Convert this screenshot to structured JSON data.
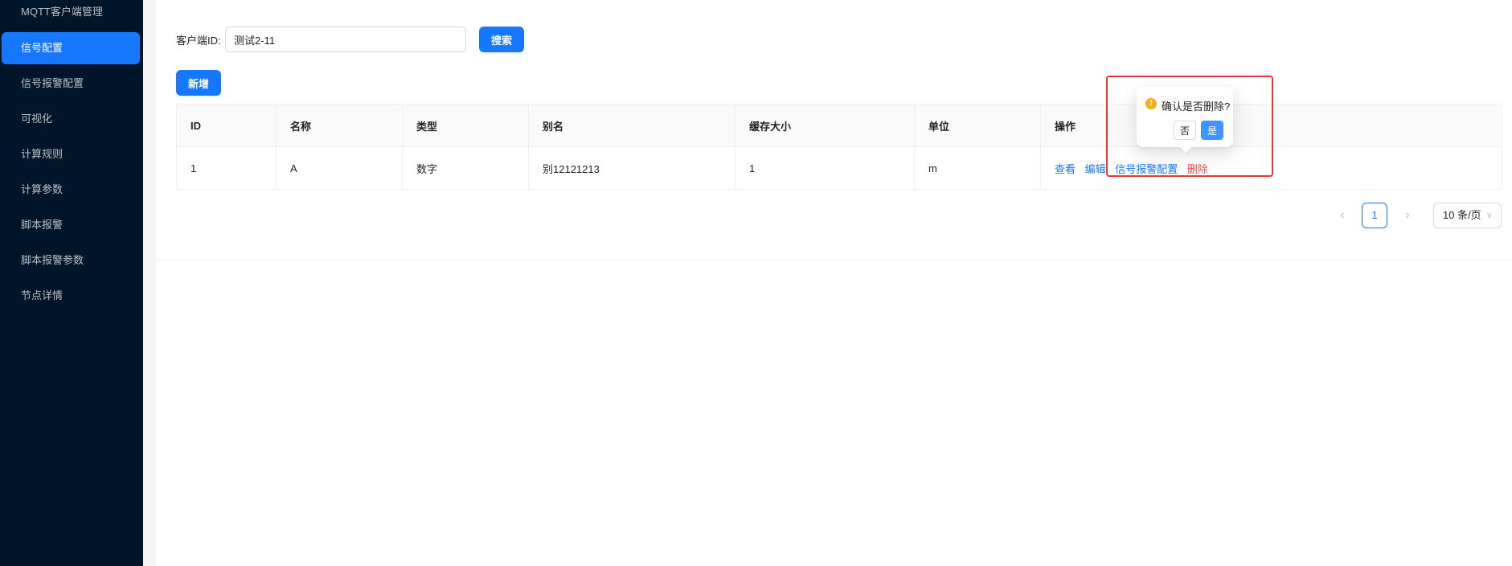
{
  "sidebar": {
    "items": [
      {
        "label": "MQTT客户端管理"
      },
      {
        "label": "信号配置"
      },
      {
        "label": "信号报警配置"
      },
      {
        "label": "可视化"
      },
      {
        "label": "计算规则"
      },
      {
        "label": "计算参数"
      },
      {
        "label": "脚本报警"
      },
      {
        "label": "脚本报警参数"
      },
      {
        "label": "节点详情"
      }
    ],
    "active": "信号配置"
  },
  "search": {
    "label": "客户端ID:",
    "value": "测试2-11",
    "button": "搜索"
  },
  "toolbar": {
    "add_label": "新增"
  },
  "table": {
    "columns": [
      "ID",
      "名称",
      "类型",
      "别名",
      "缓存大小",
      "单位",
      "操作"
    ],
    "rows": [
      {
        "id": "1",
        "name": "A",
        "type": "数字",
        "alias": "别12121213",
        "cache": "1",
        "unit": "m"
      }
    ],
    "actions": {
      "view": "查看",
      "edit": "编辑",
      "alarm": "信号报警配置",
      "delete": "删除"
    }
  },
  "pagination": {
    "current": "1",
    "prev_icon": "‹",
    "next_icon": "›",
    "page_size": "10 条/页",
    "page_size_icon": "∨"
  },
  "popconfirm": {
    "title": "确认是否删除?",
    "cancel": "否",
    "ok": "是",
    "icon": "!"
  },
  "colors": {
    "primary": "#1677ff",
    "sidebar_bg": "#001529",
    "danger": "#ff4d4f",
    "warning": "#faad14",
    "highlight": "#e53935"
  }
}
